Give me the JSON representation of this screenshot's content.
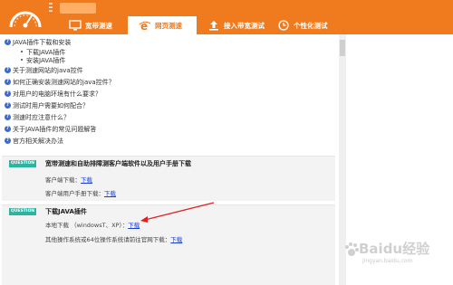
{
  "header": {
    "logo_icon": "speedometer-logo",
    "accent": "#f07a1e",
    "tabs": [
      {
        "label": "宽带测速",
        "icon": "monitor-icon"
      },
      {
        "label": "网页测速",
        "icon": "ie-icon",
        "active": true
      },
      {
        "label": "接入带宽测试",
        "icon": "upload-icon"
      },
      {
        "label": "个性化测试",
        "icon": "clock-icon"
      }
    ]
  },
  "faq": {
    "items": [
      {
        "text": "JAVA插件下载和安装"
      },
      {
        "text": "下载JAVA插件",
        "sub": true
      },
      {
        "text": "安装JAVA插件",
        "sub": true
      },
      {
        "text": "关于测速网站的java控件"
      },
      {
        "text": "如何正确安装测速网站的java控件？"
      },
      {
        "text": "对用户的电脑环境有什么要求？"
      },
      {
        "text": "测试时用户需要如何配合？"
      },
      {
        "text": "测速时应注意什么？"
      },
      {
        "text": "关于JAVA插件的常见问题解答"
      },
      {
        "text": "官方相关解决办法"
      }
    ]
  },
  "question1": {
    "badge": "QUESTION",
    "title": "宽带测速和自助排障测客户端软件以及用户手册下载",
    "line1_label": "客户端下载：",
    "line1_link": "下载",
    "line2_label": "客户端用户手册下载：",
    "line2_link": "下载"
  },
  "question2": {
    "badge": "QUESTION",
    "title": "下载JAVA插件",
    "line1_label": "本地下载 （windowsT、XP）：",
    "line1_link": "下载",
    "line2_label": "其他操作系统或64位操作系统请前往官网下载：",
    "line2_link": "下载"
  },
  "watermark": {
    "big": "Baidu经验",
    "small": "jingyan.baidu.com"
  }
}
